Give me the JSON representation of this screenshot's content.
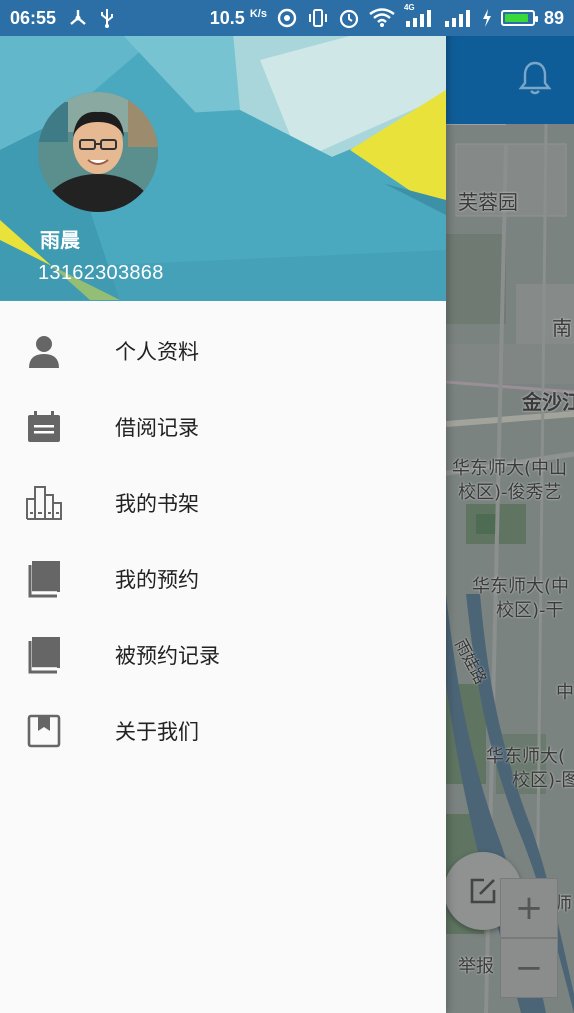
{
  "status_bar": {
    "time": "06:55",
    "network_speed": "10.5",
    "network_speed_unit": "K/s",
    "network_type": "4G",
    "battery_level": "89",
    "battery_fraction": 0.89
  },
  "drawer": {
    "user": {
      "name": "雨晨",
      "phone": "13162303868"
    },
    "menu": [
      {
        "label": "个人资料",
        "icon": "person-icon"
      },
      {
        "label": "借阅记录",
        "icon": "calendar-icon"
      },
      {
        "label": "我的书架",
        "icon": "bookshelf-icon"
      },
      {
        "label": "我的预约",
        "icon": "book-icon"
      },
      {
        "label": "被预约记录",
        "icon": "book-icon"
      },
      {
        "label": "关于我们",
        "icon": "bookmark-icon"
      }
    ]
  },
  "map": {
    "labels": {
      "furong": "芙蓉园",
      "nan": "南",
      "jinsha": "金沙江",
      "ecnu1_line1": "华东师大(中山",
      "ecnu1_line2": "校区)-俊秀艺",
      "ecnu2_line1": "华东师大(中",
      "ecnu2_line2": "校区)-干",
      "road": "雨娃路",
      "zhong": "中",
      "ecnu3_line1": "华东师大(",
      "ecnu3_line2": "校区)-图",
      "shi": "师",
      "report": "举报"
    },
    "zoom_in": "+",
    "zoom_out": "−"
  },
  "colors": {
    "header_teal": "#4aa8bf",
    "header_yellow": "#e8e23a",
    "toolbar_blue": "#0f5d98",
    "icon_grey": "#666666"
  }
}
